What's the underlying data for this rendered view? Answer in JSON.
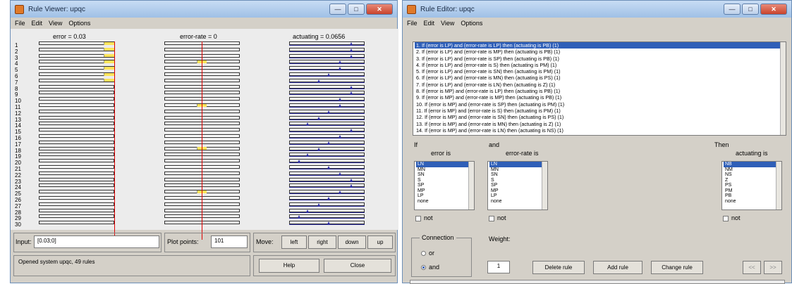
{
  "viewer": {
    "title": "Rule Viewer: upqc",
    "menu": [
      "File",
      "Edit",
      "View",
      "Options"
    ],
    "inputs": [
      "error = 0.03",
      "error-rate = 0",
      "actuating = 0.0656"
    ],
    "rule_numbers": [
      "1",
      "2",
      "3",
      "4",
      "5",
      "6",
      "7",
      "8",
      "9",
      "10",
      "11",
      "12",
      "13",
      "14",
      "15",
      "16",
      "17",
      "18",
      "19",
      "20",
      "21",
      "22",
      "23",
      "24",
      "25",
      "26",
      "27",
      "28",
      "29",
      "30"
    ],
    "input_label": "Input:",
    "input_value": "[0.03;0]",
    "plot_points_label": "Plot points:",
    "plot_points_value": "101",
    "move_label": "Move:",
    "move_buttons": [
      "left",
      "right",
      "down",
      "up"
    ],
    "status": "Opened system upqc, 49 rules",
    "help": "Help",
    "close": "Close"
  },
  "editor": {
    "title": "Rule Editor: upqc",
    "menu": [
      "File",
      "Edit",
      "View",
      "Options"
    ],
    "rules": [
      "1. If (error is LP) and (error-rate is LP) then (actuating is PB) (1)",
      "2. If (error is LP) and (error-rate is MP) then (actuating is PB) (1)",
      "3. If (error is LP) and (error-rate is SP) then (actuating is PB) (1)",
      "4. If (error is LP) and (error-rate is S) then (actuating is PM) (1)",
      "5. If (error is LP) and (error-rate is SN) then (actuating is PM) (1)",
      "6. If (error is LP) and (error-rate is MN) then (actuating is PS) (1)",
      "7. If (error is LP) and (error-rate is LN) then (actuating is Z) (1)",
      "8. If (error is MP) and (error-rate is LP) then (actuating is PB) (1)",
      "9. If (error is MP) and (error-rate is MP) then (actuating is PB) (1)",
      "10. If (error is MP) and (error-rate is SP) then (actuating is PM) (1)",
      "11. If (error is MP) and (error-rate is S) then (actuating is PM) (1)",
      "12. If (error is MP) and (error-rate is SN) then (actuating is PS) (1)",
      "13. If (error is MP) and (error-rate is MN) then (actuating is Z) (1)",
      "14. If (error is MP) and (error-rate is LN) then (actuating is NS) (1)"
    ],
    "if_label": "If",
    "and_label": "and",
    "then_label": "Then",
    "error_is": "error is",
    "error_rate_is": "error-rate is",
    "actuating_is": "actuating is",
    "error_options": [
      "LN",
      "MN",
      "SN",
      "S",
      "SP",
      "MP",
      "LP",
      "none"
    ],
    "rate_options": [
      "LN",
      "MN",
      "SN",
      "S",
      "SP",
      "MP",
      "LP",
      "none"
    ],
    "act_options": [
      "NB",
      "NM",
      "NS",
      "Z",
      "PS",
      "PM",
      "PB",
      "none"
    ],
    "not_label": "not",
    "connection_label": "Connection",
    "or_label": "or",
    "and_radio": "and",
    "weight_label": "Weight:",
    "weight_value": "1",
    "delete": "Delete rule",
    "add": "Add rule",
    "change": "Change rule",
    "prev": "<<",
    "next": ">>"
  }
}
